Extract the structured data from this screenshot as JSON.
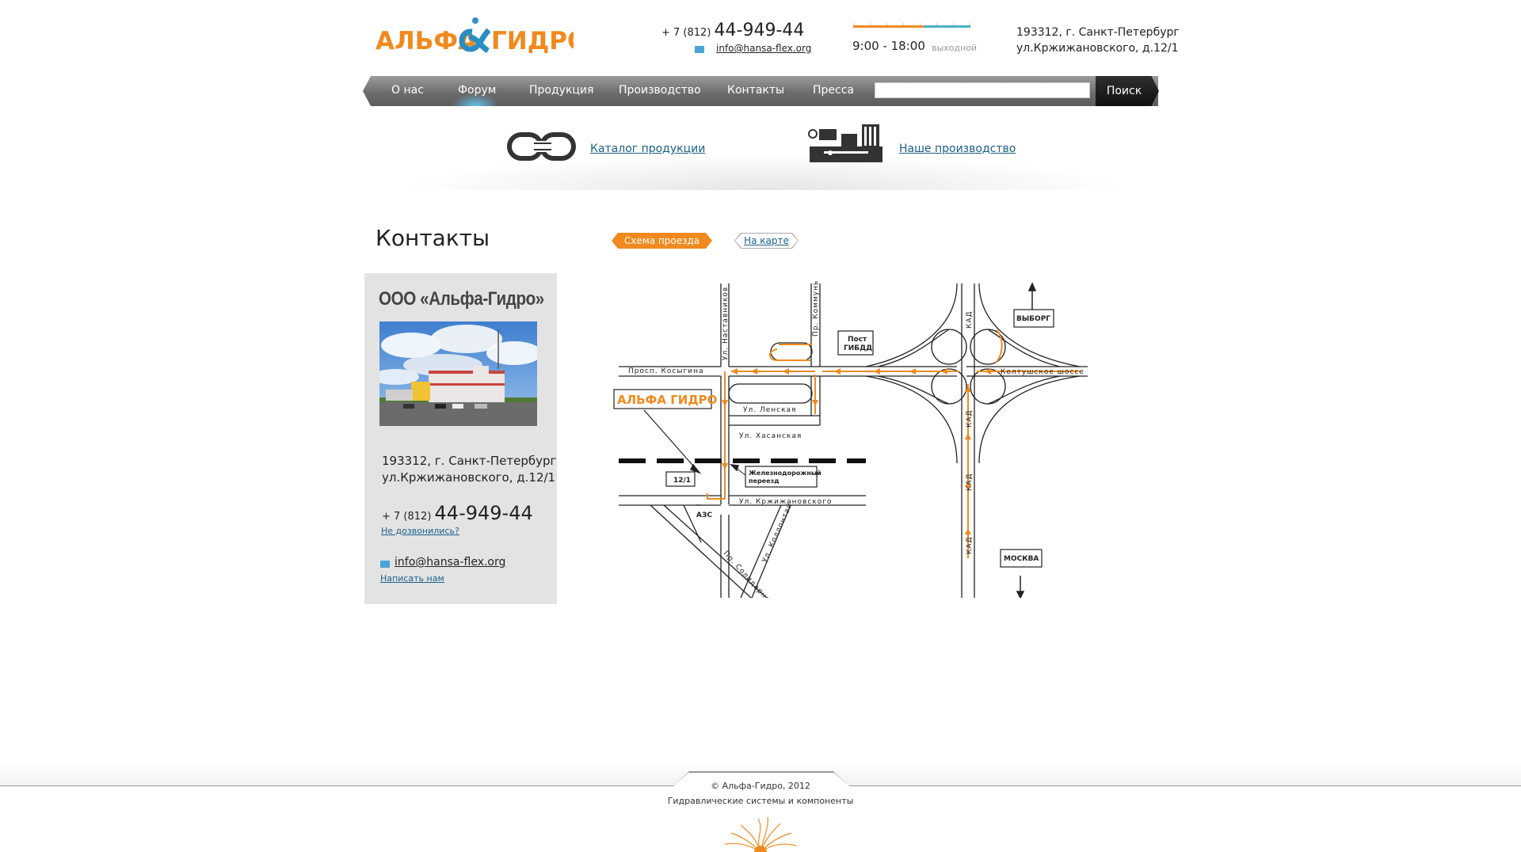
{
  "header": {
    "logo_text": "АЛЬФА ГИДРО",
    "phone_prefix": "+ 7 (812)",
    "phone_number": "44-949-44",
    "email": "info@hansa-flex.org",
    "hours": "9:00 - 18:00",
    "hours_off": "выходной",
    "address_line1": "193312, г. Санкт-Петербург",
    "address_line2": "ул.Кржижановского, д.12/1"
  },
  "nav": {
    "items": [
      {
        "label": "О нас"
      },
      {
        "label": "Форум"
      },
      {
        "label": "Продукция"
      },
      {
        "label": "Производство"
      },
      {
        "label": "Контакты"
      },
      {
        "label": "Пресса"
      }
    ],
    "search_placeholder": "",
    "search_button": "Поиск"
  },
  "quick_links": {
    "catalog": "Каталог продукции",
    "production": "Наше производство"
  },
  "content": {
    "title": "Контакты",
    "tab_scheme": "Схема проезда",
    "tab_map": "На карте"
  },
  "card": {
    "company": "ООО «Альфа-Гидро»",
    "address_line1": "193312, г. Санкт-Петербург",
    "address_line2": "ул.Кржижановского, д.12/1",
    "phone_prefix": "+ 7 (812)",
    "phone_number": "44-949-44",
    "cant_call": "Не дозвонились?",
    "email": "info@hansa-flex.org",
    "write_us": "Написать нам"
  },
  "scheme": {
    "streets": {
      "nastavnikov": "Ул. Наставников",
      "kommuny": "Пр. Коммуны",
      "kosygina": "Просп. Косыгина",
      "lenskaya": "Ул. Ленская",
      "khasanskaya": "Ул. Хасанская",
      "krzhizhanovskogo": "Ул. Кржижановского",
      "kollontai": "Ул. Коллонтай",
      "solidarnosti": "Пр. Солидарности",
      "koltushskoe": "Колтушское шоссе",
      "kad": "КАД"
    },
    "labels": {
      "post1": "Пост",
      "post2": "ГИБДД",
      "vyborg": "ВЫБОРГ",
      "moskva": "МОСКВА",
      "azs": "АЗС",
      "house": "12/1",
      "rail1": "Железнодорожный",
      "rail2": "переезд",
      "logo": "АЛЬФА ГИДРО"
    }
  },
  "footer": {
    "copyright": "© Альфа-Гидро, 2012",
    "subtitle": "Гидравлические системы и компоненты"
  },
  "colors": {
    "accent_orange": "#f08a1e",
    "link_blue": "#1a5f8c",
    "nav_gray": "#7a7a7a"
  }
}
